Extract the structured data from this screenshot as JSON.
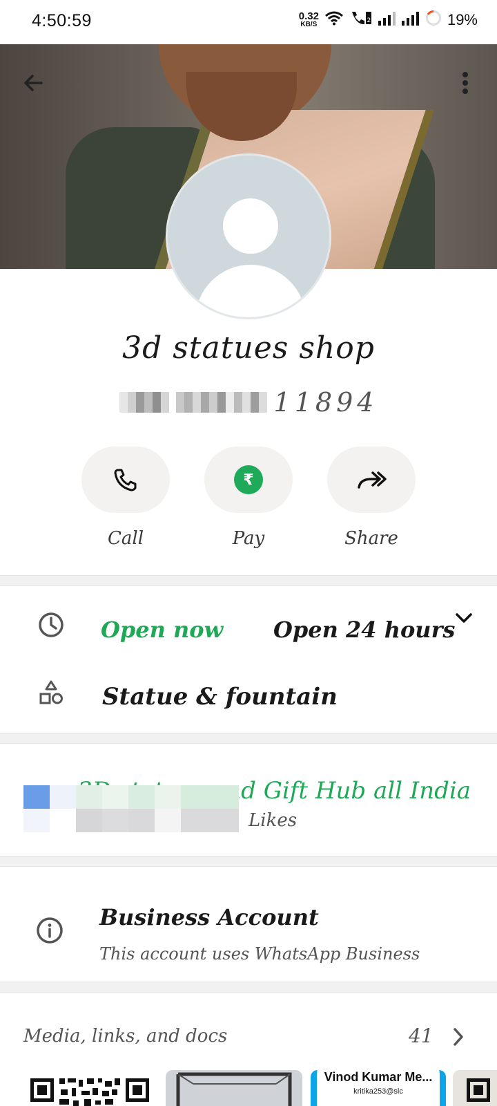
{
  "status_bar": {
    "time": "4:50:59",
    "net_speed": "0.32",
    "net_unit": "KB/S",
    "battery": "19%"
  },
  "profile": {
    "name": "3d statues shop",
    "phone_visible": "11894"
  },
  "actions": [
    {
      "label": "Call",
      "icon": "phone-icon"
    },
    {
      "label": "Pay",
      "icon": "rupee-icon"
    },
    {
      "label": "Share",
      "icon": "share-icon"
    }
  ],
  "hours": {
    "status": "Open now",
    "detail": "Open 24 hours"
  },
  "category": "Statue & fountain",
  "channel": {
    "name": "3D statues and Gift Hub all India",
    "likes_label": "Likes"
  },
  "business": {
    "title": "Business Account",
    "subtitle": "This account uses WhatsApp Business"
  },
  "media": {
    "label": "Media, links, and docs",
    "count": "41"
  },
  "thumbnails": {
    "card_title": "Vinod Kumar Me...",
    "card_sub": "kritika253@slc"
  },
  "colors": {
    "accent_green": "#1fa855",
    "pay_green": "#1faa59",
    "action_bg": "#f3f2f0",
    "avatar_bg": "#cfd8dc"
  }
}
